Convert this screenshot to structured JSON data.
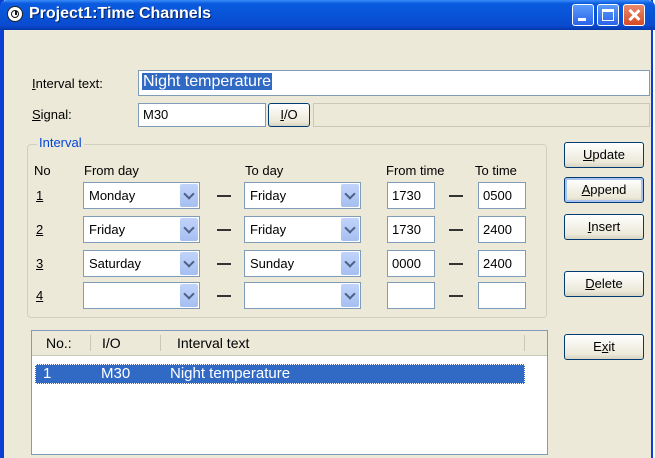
{
  "window": {
    "title": "Project1:Time Channels"
  },
  "form": {
    "interval_text_label": "Interval text:",
    "interval_text_value": "Night temperature",
    "signal_label": "Signal:",
    "signal_value": "M30",
    "io_button": "I/O"
  },
  "interval": {
    "group_title": "Interval",
    "headers": {
      "no": "No",
      "from_day": "From day",
      "to_day": "To day",
      "from_time": "From time",
      "to_time": "To time"
    },
    "rows": [
      {
        "no": "1",
        "from_day": "Monday",
        "to_day": "Friday",
        "from_time": "1730",
        "to_time": "0500"
      },
      {
        "no": "2",
        "from_day": "Friday",
        "to_day": "Friday",
        "from_time": "1730",
        "to_time": "2400"
      },
      {
        "no": "3",
        "from_day": "Saturday",
        "to_day": "Sunday",
        "from_time": "0000",
        "to_time": "2400"
      },
      {
        "no": "4",
        "from_day": "",
        "to_day": "",
        "from_time": "",
        "to_time": ""
      }
    ]
  },
  "buttons": {
    "update": "Update",
    "append": "Append",
    "insert": "Insert",
    "delete": "Delete",
    "exit": "Exit"
  },
  "list": {
    "columns": [
      "No.:",
      "I/O",
      "Interval text"
    ],
    "rows": [
      {
        "no": "1",
        "io": "M30",
        "text": "Night temperature"
      }
    ]
  }
}
